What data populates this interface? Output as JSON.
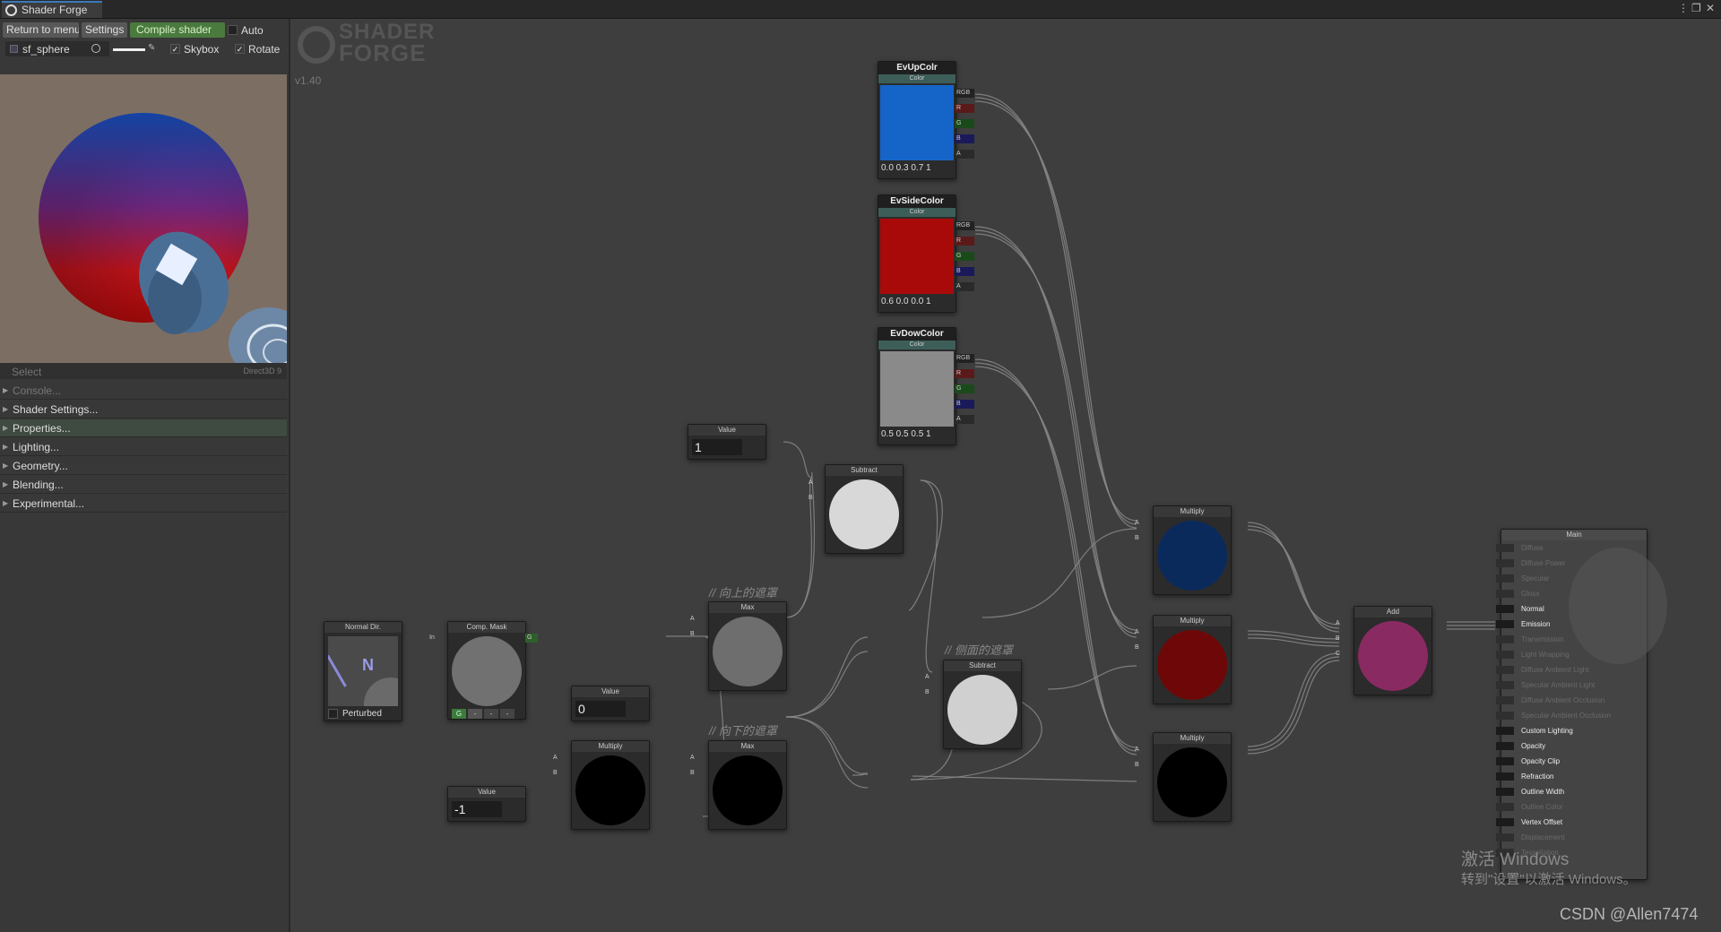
{
  "window": {
    "tab_title": "Shader Forge",
    "menu_icon": "⋮",
    "restore_icon": "❐",
    "close_icon": "✕"
  },
  "toolbar": {
    "return_label": "Return to menu",
    "settings_label": "Settings",
    "compile_label": "Compile shader",
    "auto_label": "Auto",
    "mesh_label": "sf_sphere",
    "skybox_label": "Skybox",
    "rotate_label": "Rotate"
  },
  "preview": {
    "select_label": "Select",
    "renderer_label": "Direct3D 9"
  },
  "menu": [
    {
      "label": "Console...",
      "active": false,
      "dim": true
    },
    {
      "label": "Shader Settings...",
      "active": false,
      "dim": false
    },
    {
      "label": "Properties...",
      "active": true,
      "dim": false
    },
    {
      "label": "Lighting...",
      "active": false,
      "dim": false
    },
    {
      "label": "Geometry...",
      "active": false,
      "dim": false
    },
    {
      "label": "Blending...",
      "active": false,
      "dim": false
    },
    {
      "label": "Experimental...",
      "active": false,
      "dim": false
    }
  ],
  "branding": {
    "logo_top": "SHADER",
    "logo_bottom": "FORGE",
    "version": "v1.40"
  },
  "colors": {
    "up": "#1565c8",
    "side": "#a80a0a",
    "down": "#8a8a8a",
    "mult_up": "#0b2a5c",
    "mult_side": "#6e0808",
    "add": "#8a2a62"
  },
  "nodes": {
    "ev_up": {
      "title": "EvUpColr",
      "type": "Color",
      "values": "0.0  0.3  0.7  1"
    },
    "ev_side": {
      "title": "EvSideColor",
      "type": "Color",
      "values": "0.6  0.0  0.0  1"
    },
    "ev_down": {
      "title": "EvDowColor",
      "type": "Color",
      "values": "0.5  0.5  0.5  1"
    },
    "color_ports": [
      "RGB",
      "R",
      "G",
      "B",
      "A"
    ],
    "value1": {
      "title": "Value",
      "value": "1"
    },
    "value0": {
      "title": "Value",
      "value": "0"
    },
    "valueneg": {
      "title": "Value",
      "value": "-1"
    },
    "subtract1": {
      "title": "Subtract"
    },
    "subtract2": {
      "title": "Subtract"
    },
    "max_up": {
      "title": "Max"
    },
    "max_down": {
      "title": "Max"
    },
    "multiply_low": {
      "title": "Multiply"
    },
    "multiply_up": {
      "title": "Multiply"
    },
    "multiply_side": {
      "title": "Multiply"
    },
    "multiply_down": {
      "title": "Multiply"
    },
    "add": {
      "title": "Add"
    },
    "normal_dir": {
      "title": "Normal Dir.",
      "glyph": "N",
      "checkbox_label": "Perturbed"
    },
    "comp_mask": {
      "title": "Comp. Mask",
      "in_label": "In",
      "out_label": "G",
      "channels": [
        "G",
        "-",
        "-",
        "-"
      ]
    },
    "port_a": "A",
    "port_b": "B",
    "port_c": "C"
  },
  "comments": {
    "up_mask": "// 向上的遮罩",
    "side_mask": "// 侧面的遮罩",
    "down_mask": "// 向下的遮罩"
  },
  "main_node": {
    "title": "Main",
    "inputs": [
      {
        "label": "Diffuse",
        "active": false
      },
      {
        "label": "Diffuse Power",
        "active": false
      },
      {
        "label": "Specular",
        "active": false
      },
      {
        "label": "Gloss",
        "active": false
      },
      {
        "label": "Normal",
        "active": true
      },
      {
        "label": "Emission",
        "active": true
      },
      {
        "label": "Transmission",
        "active": false
      },
      {
        "label": "Light Wrapping",
        "active": false
      },
      {
        "label": "Diffuse Ambient Light",
        "active": false
      },
      {
        "label": "Specular Ambient Light",
        "active": false
      },
      {
        "label": "Diffuse Ambient Occlusion",
        "active": false
      },
      {
        "label": "Specular Ambient Occlusion",
        "active": false
      },
      {
        "label": "Custom Lighting",
        "active": true
      },
      {
        "label": "Opacity",
        "active": true
      },
      {
        "label": "Opacity Clip",
        "active": true
      },
      {
        "label": "Refraction",
        "active": true
      },
      {
        "label": "Outline Width",
        "active": true
      },
      {
        "label": "Outline Color",
        "active": false
      },
      {
        "label": "Vertex Offset",
        "active": true
      },
      {
        "label": "Displacement",
        "active": false
      },
      {
        "label": "Tessellation",
        "active": false
      }
    ]
  },
  "overlay": {
    "activate_title": "激活 Windows",
    "activate_sub": "转到\"设置\"以激活 Windows。",
    "credit": "CSDN @Allen7474"
  }
}
